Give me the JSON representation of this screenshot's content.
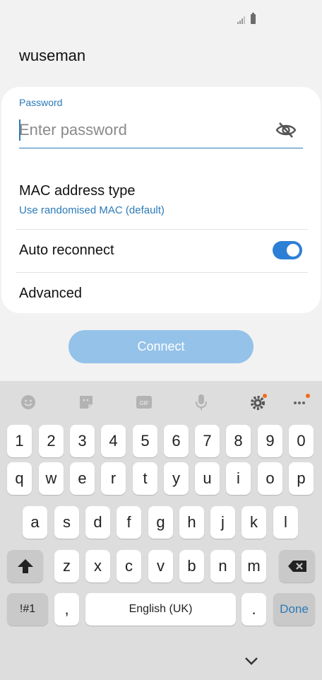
{
  "status_bar": {
    "signal_icon": "signal-icon",
    "battery_icon": "battery-icon"
  },
  "network": {
    "ssid": "wuseman"
  },
  "password": {
    "label": "Password",
    "placeholder": "Enter password",
    "value": "",
    "visibility_icon": "eye-off-icon"
  },
  "mac": {
    "title": "MAC address type",
    "value": "Use randomised MAC (default)"
  },
  "auto_reconnect": {
    "label": "Auto reconnect",
    "enabled": true
  },
  "advanced": {
    "label": "Advanced"
  },
  "connect_button": {
    "label": "Connect"
  },
  "keyboard": {
    "toolbar": [
      "emoji-icon",
      "sticker-icon",
      "gif-icon",
      "mic-icon",
      "settings-icon",
      "more-icon"
    ],
    "gif_label": "GIF",
    "row_numbers": [
      "1",
      "2",
      "3",
      "4",
      "5",
      "6",
      "7",
      "8",
      "9",
      "0"
    ],
    "row_top": [
      "q",
      "w",
      "e",
      "r",
      "t",
      "y",
      "u",
      "i",
      "o",
      "p"
    ],
    "row_middle": [
      "a",
      "s",
      "d",
      "f",
      "g",
      "h",
      "j",
      "k",
      "l"
    ],
    "row_bottom": [
      "z",
      "x",
      "c",
      "v",
      "b",
      "n",
      "m"
    ],
    "symbols_key": "!#1",
    "comma_key": ",",
    "space_key": "English (UK)",
    "period_key": ".",
    "done_key": "Done",
    "shift_icon": "shift-icon",
    "backspace_icon": "backspace-icon",
    "hide_icon": "chevron-down-icon"
  },
  "colors": {
    "accent": "#2b7ab8",
    "toggle_on": "#2d7fd6",
    "connect_disabled": "#94c2e9",
    "keyboard_bg": "#dddddd"
  }
}
